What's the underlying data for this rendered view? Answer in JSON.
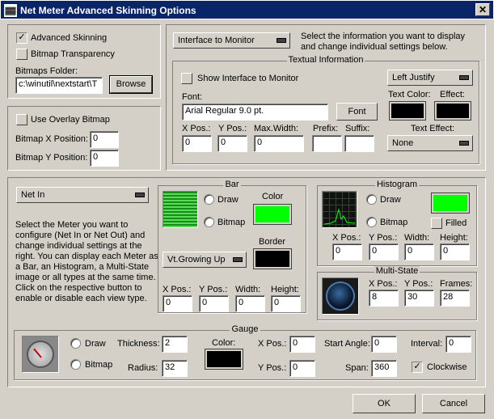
{
  "window": {
    "title": "Net Meter Advanced Skinning Options",
    "app_icon": "app-icon",
    "close_glyph": "✕"
  },
  "general": {
    "advanced_skinning": "Advanced Skinning",
    "bitmap_transparency": "Bitmap Transparency",
    "bitmaps_folder_label": "Bitmaps Folder:",
    "bitmaps_folder_value": "c:\\winutil\\nextstart\\T",
    "browse": "Browse",
    "check_glyph": "✓"
  },
  "overlay": {
    "use_overlay": "Use Overlay Bitmap",
    "x_label": "Bitmap X Position:",
    "x_value": "0",
    "y_label": "Bitmap Y Position:",
    "y_value": "0"
  },
  "info": {
    "dropdown": "Interface to Monitor",
    "description": "Select the information you want to display and change individual settings below."
  },
  "textual": {
    "title": "Textual Information",
    "show_interface": "Show Interface to Monitor",
    "justify": "Left Justify",
    "font_label": "Font:",
    "font_value": "Arial Regular 9.0 pt.",
    "font_button": "Font",
    "text_color_label": "Text Color:",
    "effect_label": "Effect:",
    "xpos_label": "X Pos.:",
    "xpos_value": "0",
    "ypos_label": "Y Pos.:",
    "ypos_value": "0",
    "maxwidth_label": "Max.Width:",
    "maxwidth_value": "0",
    "prefix_label": "Prefix:",
    "prefix_value": "",
    "suffix_label": "Suffix:",
    "suffix_value": "",
    "text_effect_label": "Text Effect:",
    "text_effect_value": "None"
  },
  "meter": {
    "dropdown": "Net In",
    "description": "Select the Meter you want to configure (Net In or Net Out) and change individual settings at the right. You can display each Meter as a Bar, an Histogram, a Multi-State image or all types at the same time. Click on the respective button to enable or disable each view type."
  },
  "bar": {
    "title": "Bar",
    "draw": "Draw",
    "bitmap": "Bitmap",
    "color_label": "Color",
    "border_label": "Border",
    "growth": "Vt.Growing Up",
    "xpos_label": "X Pos.:",
    "xpos_value": "0",
    "ypos_label": "Y Pos.:",
    "ypos_value": "0",
    "width_label": "Width:",
    "width_value": "0",
    "height_label": "Height:",
    "height_value": "0"
  },
  "histogram": {
    "title": "Histogram",
    "draw": "Draw",
    "bitmap": "Bitmap",
    "filled": "Filled",
    "xpos_label": "X Pos.:",
    "xpos_value": "0",
    "ypos_label": "Y Pos.:",
    "ypos_value": "0",
    "width_label": "Width:",
    "width_value": "0",
    "height_label": "Height:",
    "height_value": "0"
  },
  "multistate": {
    "title": "Multi-State",
    "xpos_label": "X Pos.:",
    "xpos_value": "8",
    "ypos_label": "Y Pos.:",
    "ypos_value": "30",
    "frames_label": "Frames:",
    "frames_value": "28"
  },
  "gauge": {
    "title": "Gauge",
    "draw": "Draw",
    "bitmap": "Bitmap",
    "thickness_label": "Thickness:",
    "thickness_value": "2",
    "radius_label": "Radius:",
    "radius_value": "32",
    "color_label": "Color:",
    "xpos_label": "X Pos.:",
    "xpos_value": "0",
    "ypos_label": "Y Pos.:",
    "ypos_value": "0",
    "start_angle_label": "Start Angle:",
    "start_angle_value": "0",
    "span_label": "Span:",
    "span_value": "360",
    "interval_label": "Interval:",
    "interval_value": "0",
    "clockwise": "Clockwise"
  },
  "footer": {
    "ok": "OK",
    "cancel": "Cancel"
  },
  "colors": {
    "title_bar": "#0a246a",
    "face": "#d4d0c8",
    "bar_green": "#00ff00",
    "swatch_black": "#000000"
  }
}
